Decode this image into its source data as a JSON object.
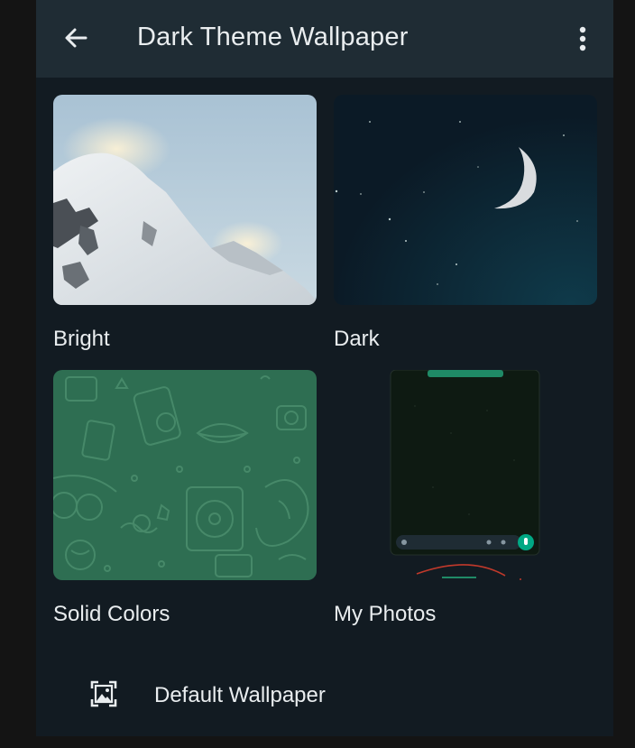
{
  "header": {
    "title": "Dark Theme Wallpaper",
    "back_icon": "arrow-left-icon",
    "menu_icon": "more-vert-icon"
  },
  "categories": [
    {
      "label": "Bright"
    },
    {
      "label": "Dark"
    },
    {
      "label": "Solid Colors"
    },
    {
      "label": "My Photos"
    }
  ],
  "default_wallpaper": {
    "label": "Default Wallpaper",
    "icon": "wallpaper-icon"
  },
  "colors": {
    "header_bg": "#1f2c34",
    "page_bg": "#121b22",
    "text": "#e9edef",
    "accent": "#00a884",
    "pattern_green": "#2e6e52"
  }
}
